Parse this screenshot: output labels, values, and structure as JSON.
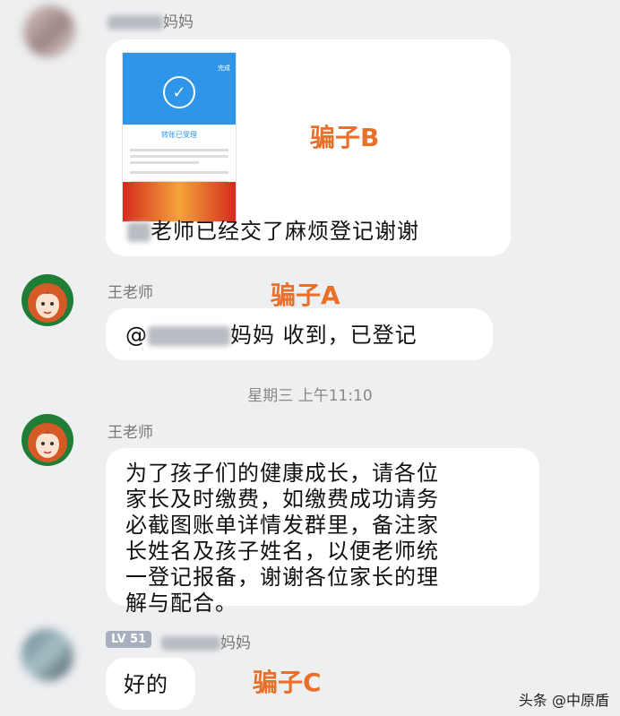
{
  "messages": [
    {
      "sender_suffix": "妈妈",
      "image": {
        "title": "转账已受理",
        "top_right": "完成"
      },
      "text_suffix": "老师已经交了麻烦登记谢谢",
      "annotation": "骗子B"
    },
    {
      "sender": "王老师",
      "text_prefix": "@",
      "text_suffix": "妈妈 收到，已登记",
      "annotation": "骗子A"
    },
    {
      "timestamp": "星期三 上午11:10"
    },
    {
      "sender": "王老师",
      "text_lines": [
        "为了孩子们的健康成长，请各位",
        "家长及时缴费，如缴费成功请务",
        "必截图账单详情发群里，备注家",
        "长姓名及孩子姓名，以便老师统",
        "一登记报备，谢谢各位家长的理",
        "解与配合。"
      ]
    },
    {
      "level_badge": "LV 51",
      "sender_suffix": "妈妈",
      "text": "好的",
      "annotation": "骗子C"
    }
  ],
  "watermark": "头条 @中原盾",
  "colors": {
    "background": "#eeeff1",
    "bubble": "#ffffff",
    "annotation": "#e8702a",
    "level_badge": "#a8b0bd"
  }
}
